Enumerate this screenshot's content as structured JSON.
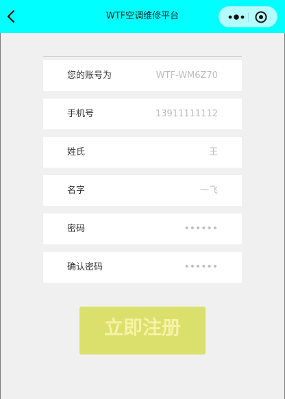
{
  "nav": {
    "title": "WTF空调维修平台"
  },
  "form": {
    "rows": [
      {
        "label": "您的账号为",
        "value": "WTF-WM6Z70"
      },
      {
        "label": "手机号",
        "value": "13911111112"
      },
      {
        "label": "姓氏",
        "value": "王"
      },
      {
        "label": "名字",
        "value": "一飞"
      },
      {
        "label": "密码",
        "value": "••••••"
      },
      {
        "label": "确认密码",
        "value": "••••••"
      }
    ]
  },
  "submit": {
    "label": "立即注册"
  },
  "colors": {
    "nav_bg": "#00ffff",
    "page_bg": "#f0f0f0",
    "button_bg": "#dbe06c"
  },
  "icons": {
    "back": "chevron-left-icon",
    "more": "more-dots-icon",
    "close": "target-circle-icon"
  }
}
